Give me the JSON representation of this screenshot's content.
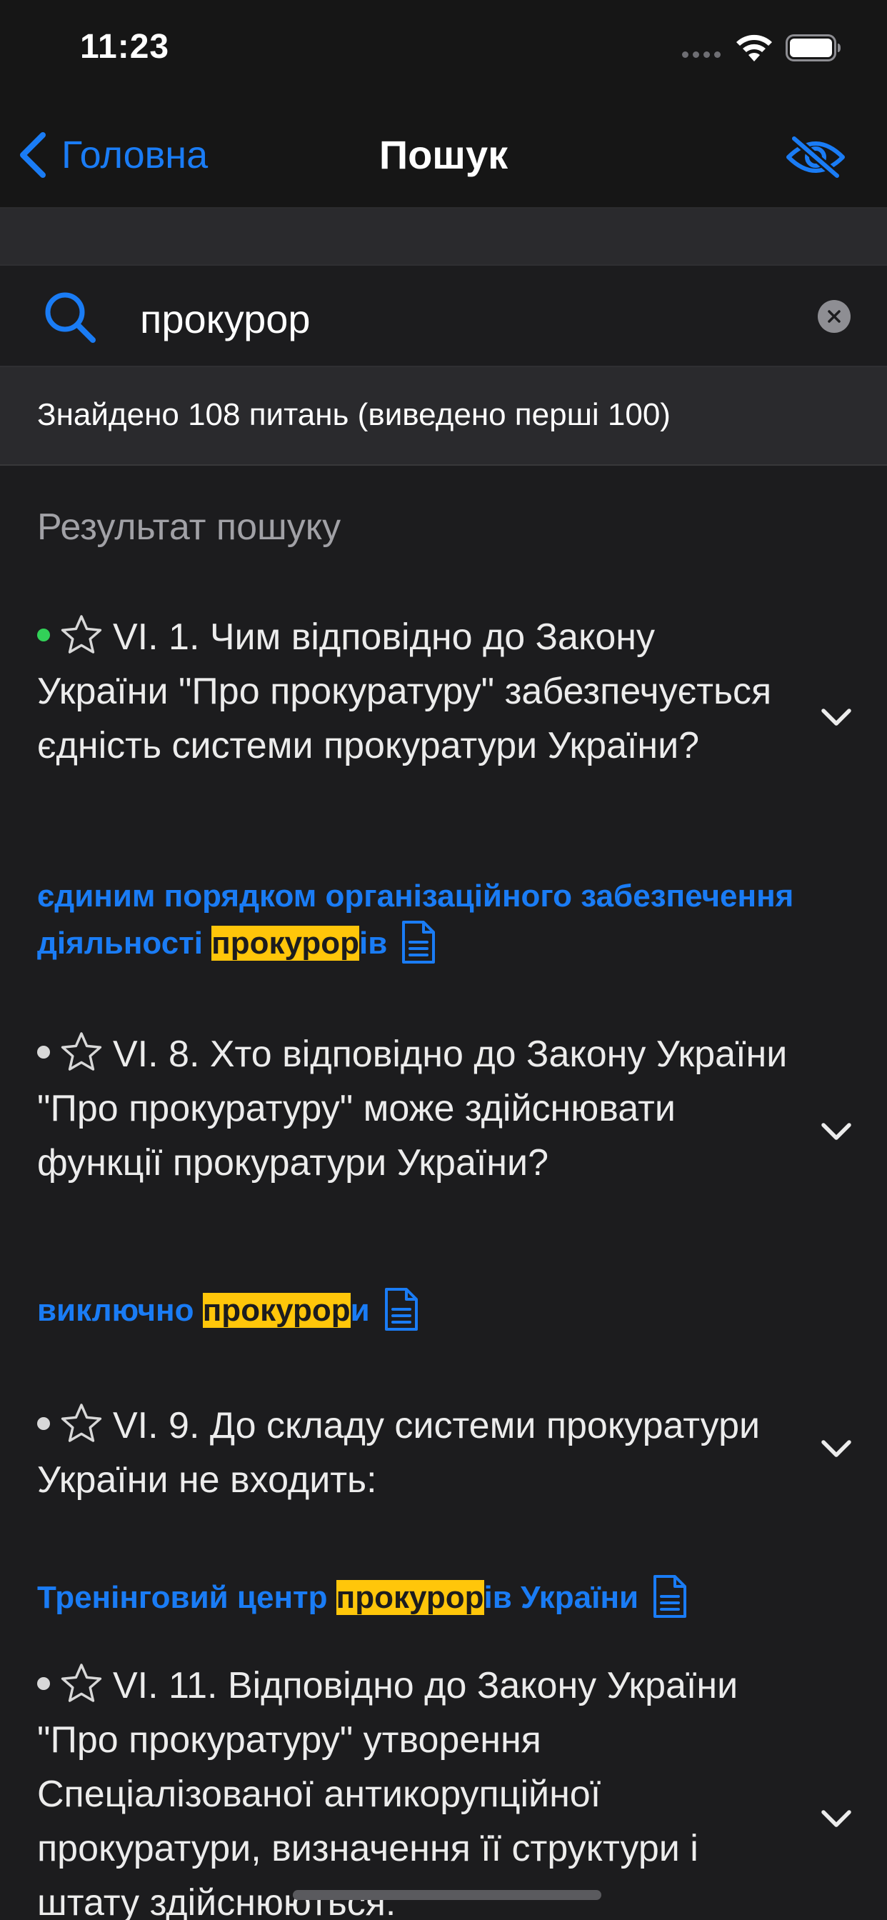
{
  "status_bar": {
    "time": "11:23"
  },
  "nav": {
    "back_label": "Головна",
    "title": "Пошук"
  },
  "search": {
    "value": "прокурор"
  },
  "found_text": "Знайдено 108 питань (виведено перші 100)",
  "section_title": "Результат пошуку",
  "results": [
    {
      "status": "green",
      "question": "VI. 1. Чим відповідно до Закону України \"Про прокуратуру\" забезпечується єдність системи прокуратури України?",
      "answer_before": "єдиним порядком організаційного забезпечення діяльності ",
      "answer_highlight": "прокурор",
      "answer_after": "ів"
    },
    {
      "status": "gray",
      "question": "VI. 8. Хто відповідно до Закону України \"Про прокуратуру\" може здійснювати функції прокуратури України?",
      "answer_before": "виключно ",
      "answer_highlight": "прокурор",
      "answer_after": "и"
    },
    {
      "status": "gray",
      "question": "VI. 9. До складу системи прокуратури України не входить:",
      "answer_before": "Тренінговий центр ",
      "answer_highlight": "прокурор",
      "answer_after": "ів України"
    },
    {
      "status": "gray",
      "question": "VI. 11. Відповідно до Закону України \"Про прокуратуру\" утворення Спеціалізованої антикорупційної прокуратури, визначення її структури і штату здійснюються:",
      "answer_before": "",
      "answer_highlight": "",
      "answer_after": ""
    }
  ],
  "colors": {
    "accent": "#1a7cf5",
    "highlight": "#ffc60a",
    "status_green": "#32d158",
    "background": "#1c1c1e"
  }
}
